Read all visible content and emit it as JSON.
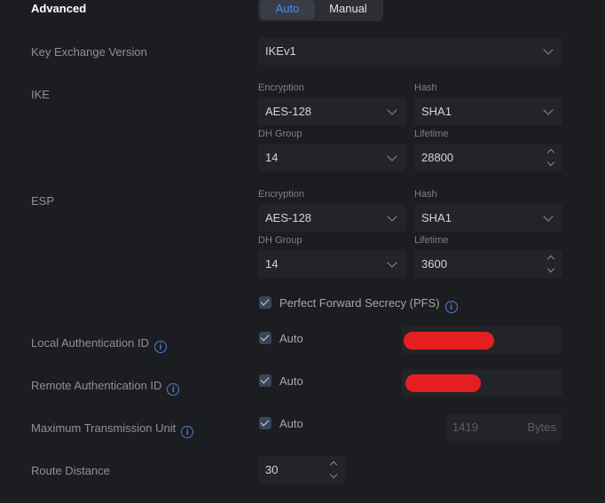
{
  "section": {
    "title": "Advanced"
  },
  "mode_toggle": {
    "auto": "Auto",
    "manual": "Manual"
  },
  "key_exchange": {
    "label": "Key Exchange Version",
    "value": "IKEv1"
  },
  "ike": {
    "label": "IKE",
    "encryption_label": "Encryption",
    "encryption": "AES-128",
    "hash_label": "Hash",
    "hash": "SHA1",
    "dh_label": "DH Group",
    "dh": "14",
    "lifetime_label": "Lifetime",
    "lifetime": "28800"
  },
  "esp": {
    "label": "ESP",
    "encryption_label": "Encryption",
    "encryption": "AES-128",
    "hash_label": "Hash",
    "hash": "SHA1",
    "dh_label": "DH Group",
    "dh": "14",
    "lifetime_label": "Lifetime",
    "lifetime": "3600"
  },
  "pfs": {
    "label": "Perfect Forward Secrecy (PFS)"
  },
  "local_auth": {
    "label": "Local Authentication ID",
    "auto": "Auto"
  },
  "remote_auth": {
    "label": "Remote Authentication ID",
    "auto": "Auto"
  },
  "mtu": {
    "label": "Maximum Transmission Unit",
    "auto": "Auto",
    "value": "1419",
    "unit": "Bytes"
  },
  "route": {
    "label": "Route Distance",
    "value": "30"
  },
  "colors": {
    "accent": "#4a8cff",
    "background": "#1c1d21",
    "field": "#232428",
    "redaction": "#e51f1f"
  }
}
